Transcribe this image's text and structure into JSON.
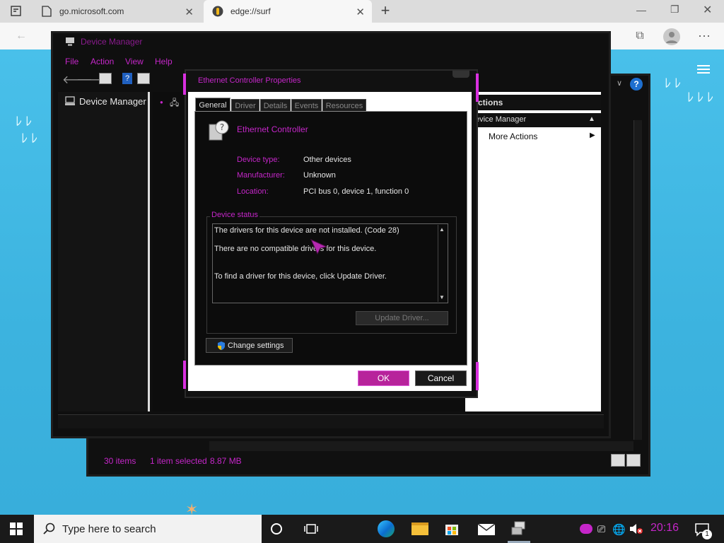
{
  "browser": {
    "tabs": [
      {
        "label": "go.microsoft.com"
      },
      {
        "label": "edge://surf"
      }
    ]
  },
  "device_manager": {
    "title": "Device Manager",
    "menu": [
      "File",
      "Action",
      "View",
      "Help"
    ],
    "tree_root": "Device Manager"
  },
  "actions_panel": {
    "header": "ctions",
    "section": "evice Manager",
    "more_actions": "More Actions"
  },
  "explorer_status": {
    "items_count": "30 items",
    "selected": "1 item selected",
    "size": "8.87 MB"
  },
  "properties": {
    "title": "Ethernet Controller Properties",
    "tabs": [
      "General",
      "Driver",
      "Details",
      "Events",
      "Resources"
    ],
    "device_name": "Ethernet Controller",
    "fields": [
      {
        "label": "Device type:",
        "value": "Other devices"
      },
      {
        "label": "Manufacturer:",
        "value": "Unknown"
      },
      {
        "label": "Location:",
        "value": "PCI bus 0, device 1, function 0"
      }
    ],
    "status_group": "Device status",
    "status_lines": [
      "The drivers for this device are not installed. (Code 28)",
      "There are no compatible drivers for this device.",
      "To find a driver for this device, click Update Driver."
    ],
    "update_driver": "Update Driver...",
    "change_settings": "Change settings",
    "ok": "OK",
    "cancel": "Cancel"
  },
  "taskbar": {
    "search_placeholder": "Type here to search",
    "time": "20:16",
    "notif_count": "1"
  },
  "colors": {
    "accent": "#c526c9",
    "ok_button": "#b7239b"
  }
}
